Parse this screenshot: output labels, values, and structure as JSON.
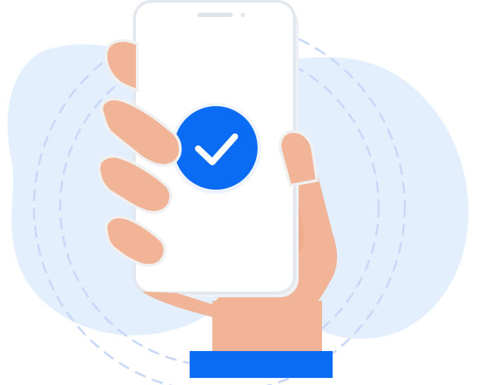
{
  "illustration": {
    "subject": "hand-holding-phone-with-check",
    "icons": {
      "status": "check-icon"
    },
    "colors": {
      "background_blob": "#e3effd",
      "dashed_rings": "#c9d8f8",
      "phone_body": "#ffffff",
      "phone_shadow": "#eef1f5",
      "phone_edge": "#e3e7ee",
      "speaker": "#dfe3ea",
      "skin": "#f1b496",
      "skin_shadow": "#d99f82",
      "nail_outline": "#f0f0f0",
      "check_circle": "#0a6bf5",
      "check_mark": "#ffffff",
      "cuff": "#0a6bf5"
    }
  }
}
